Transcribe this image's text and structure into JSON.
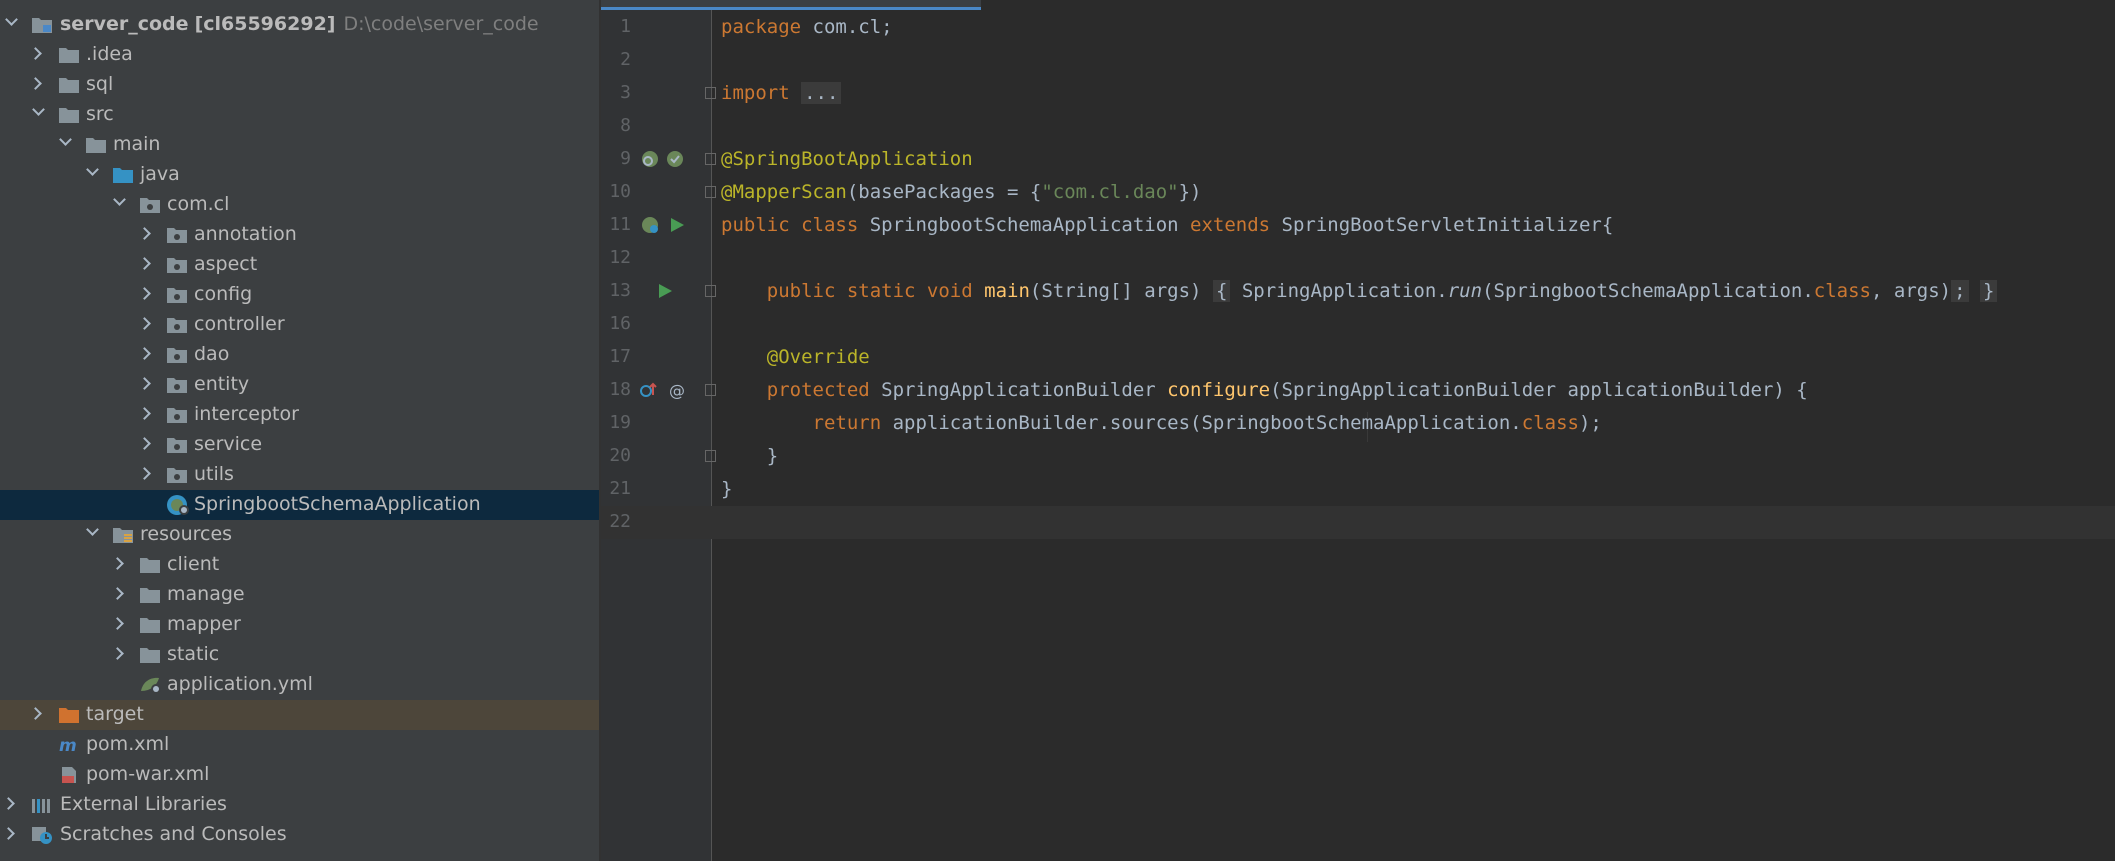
{
  "project_tree": {
    "root": {
      "name": "server_code",
      "module": "[cl65596292]",
      "path": "D:\\code\\server_code"
    },
    "items": [
      {
        "label": ".idea"
      },
      {
        "label": "sql"
      },
      {
        "label": "src"
      },
      {
        "label": "main"
      },
      {
        "label": "java"
      },
      {
        "label": "com.cl"
      },
      {
        "label": "annotation"
      },
      {
        "label": "aspect"
      },
      {
        "label": "config"
      },
      {
        "label": "controller"
      },
      {
        "label": "dao"
      },
      {
        "label": "entity"
      },
      {
        "label": "interceptor"
      },
      {
        "label": "service"
      },
      {
        "label": "utils"
      },
      {
        "label": "SpringbootSchemaApplication"
      },
      {
        "label": "resources"
      },
      {
        "label": "client"
      },
      {
        "label": "manage"
      },
      {
        "label": "mapper"
      },
      {
        "label": "static"
      },
      {
        "label": "application.yml"
      },
      {
        "label": "target"
      },
      {
        "label": "pom.xml"
      },
      {
        "label": "pom-war.xml"
      },
      {
        "label": "External Libraries"
      },
      {
        "label": "Scratches and Consoles"
      }
    ]
  },
  "editor": {
    "line_numbers": [
      "1",
      "2",
      "3",
      "8",
      "9",
      "10",
      "11",
      "12",
      "13",
      "16",
      "17",
      "18",
      "19",
      "20",
      "21",
      "22"
    ],
    "lines": {
      "l1_kw": "package",
      "l1_rest": " com.cl;",
      "l3_kw": "import",
      "l3_fold": "...",
      "l9_ann": "@SpringBootApplication",
      "l10_ann": "@MapperScan",
      "l10_a": "(basePackages = {",
      "l10_str": "\"com.cl.dao\"",
      "l10_b": "})",
      "l11_kw1": "public class",
      "l11_a": " SpringbootSchemaApplication ",
      "l11_kw2": "extends",
      "l11_b": " SpringBootServletInitializer{",
      "l13_kw": "public static void",
      "l13_fn": "main",
      "l13_a": "(String[] args)",
      "l13_open": "{",
      "l13_b": " SpringApplication.",
      "l13_run": "run",
      "l13_c": "(SpringbootSchemaApplication.",
      "l13_cls": "class",
      "l13_d": ", args)",
      "l13_semi": ";",
      "l13_close": "}",
      "l17_ann": "@Override",
      "l18_kw": "protected",
      "l18_a": " SpringApplicationBuilder ",
      "l18_fn": "configure",
      "l18_b": "(SpringApplicationBuilder applicationBuilder) {",
      "l19_kw": "return",
      "l19_a": " applicationBuilder.sources(SpringbootSchemaApplication.",
      "l19_cls": "class",
      "l19_b": ");",
      "l20": "}",
      "l21": "}"
    }
  }
}
